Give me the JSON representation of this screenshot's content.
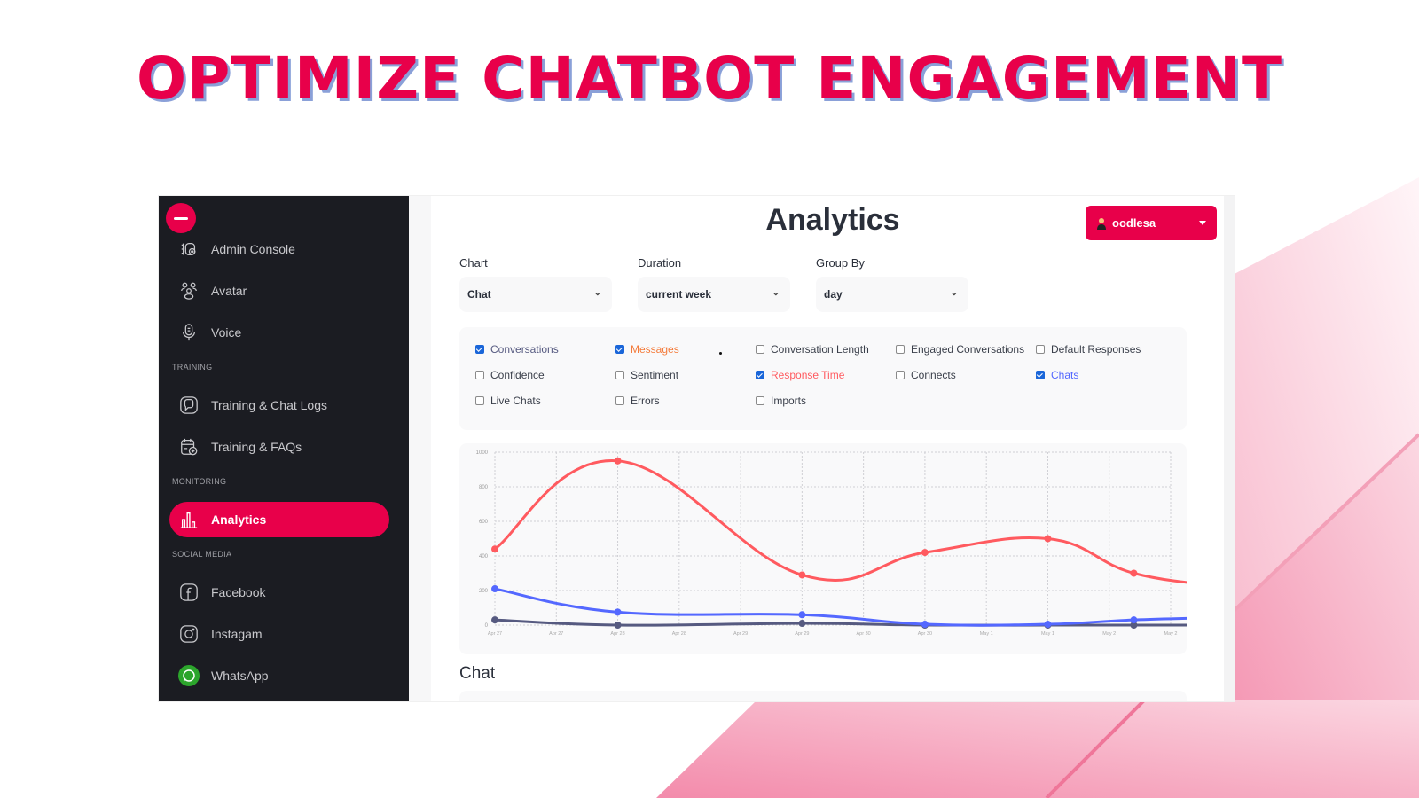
{
  "headline": "OPTIMIZE CHATBOT ENGAGEMENT",
  "colors": {
    "brand": "#e8004a",
    "sidebar_bg": "#1b1c22",
    "response_time": "#ff5a5f",
    "chats": "#5468ff",
    "conversations": "#565a80"
  },
  "sidebar": {
    "collapse_icon": "minus-icon",
    "items_top": [
      {
        "label": "Admin Console",
        "icon": "admin-console-icon"
      },
      {
        "label": "Avatar",
        "icon": "avatar-icon"
      },
      {
        "label": "Voice",
        "icon": "microphone-icon"
      }
    ],
    "sections": [
      {
        "label": "TRAINING",
        "items": [
          {
            "label": "Training & Chat Logs",
            "icon": "chat-logs-icon"
          },
          {
            "label": "Training & FAQs",
            "icon": "faq-calendar-icon"
          }
        ]
      },
      {
        "label": "MONITORING",
        "items": [
          {
            "label": "Analytics",
            "icon": "bar-chart-icon",
            "active": true
          }
        ]
      },
      {
        "label": "SOCIAL MEDIA",
        "items": [
          {
            "label": "Facebook",
            "icon": "facebook-icon"
          },
          {
            "label": "Instagam",
            "icon": "instagram-icon"
          },
          {
            "label": "WhatsApp",
            "icon": "whatsapp-icon"
          }
        ]
      }
    ]
  },
  "header": {
    "title": "Analytics",
    "user": {
      "name": "oodlesa",
      "icon": "user-icon"
    }
  },
  "filters": {
    "chart": {
      "label": "Chart",
      "value": "Chat"
    },
    "duration": {
      "label": "Duration",
      "value": "current week"
    },
    "group_by": {
      "label": "Group By",
      "value": "day"
    }
  },
  "metrics": [
    {
      "label": "Conversations",
      "checked": true,
      "color": "#565a80"
    },
    {
      "label": "Messages",
      "checked": true,
      "color": "#f47b3a"
    },
    {
      "label": "Conversation Length",
      "checked": false
    },
    {
      "label": "Engaged Conversations",
      "checked": false
    },
    {
      "label": "Default Responses",
      "checked": false
    },
    {
      "label": "Confidence",
      "checked": false
    },
    {
      "label": "Sentiment",
      "checked": false
    },
    {
      "label": "Response Time",
      "checked": true,
      "color": "#ff5a5f"
    },
    {
      "label": "Connects",
      "checked": false
    },
    {
      "label": "Chats",
      "checked": true,
      "color": "#5468ff"
    },
    {
      "label": "Live Chats",
      "checked": false
    },
    {
      "label": "Errors",
      "checked": false
    },
    {
      "label": "Imports",
      "checked": false
    }
  ],
  "section_title": "Chat",
  "chart_data": {
    "type": "line",
    "title": "",
    "xlabel": "",
    "ylabel": "",
    "ylim": [
      0,
      1000
    ],
    "yticks": [
      0,
      200,
      400,
      600,
      800,
      1000
    ],
    "x_tick_labels": [
      "Apr 27",
      "Apr 27",
      "Apr 28",
      "Apr 28",
      "Apr 29",
      "Apr 29",
      "Apr 30",
      "Apr 30",
      "May 1",
      "May 1",
      "May 2",
      "May 2"
    ],
    "grid": true,
    "x": [
      0,
      2,
      5,
      7,
      9,
      10.4,
      12
    ],
    "series": [
      {
        "name": "Response Time",
        "color": "#ff5a5f",
        "values": [
          440,
          950,
          290,
          420,
          500,
          300,
          220
        ]
      },
      {
        "name": "Chats",
        "color": "#5468ff",
        "values": [
          210,
          75,
          60,
          5,
          5,
          30,
          45
        ]
      },
      {
        "name": "Conversations",
        "color": "#565a80",
        "values": [
          30,
          0,
          10,
          0,
          0,
          0,
          0
        ]
      }
    ]
  }
}
